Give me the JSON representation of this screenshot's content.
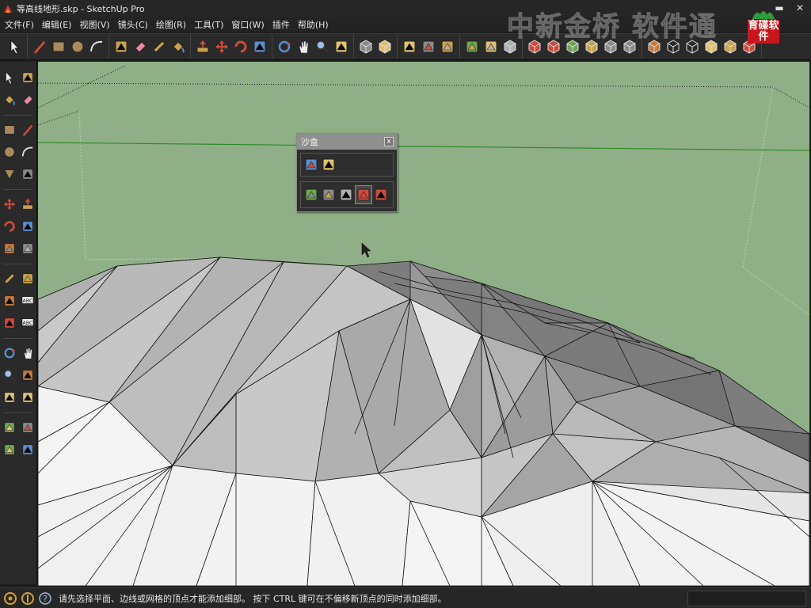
{
  "window": {
    "title": "等高线地形.skp - SketchUp Pro",
    "controls": [
      "minimize-icon",
      "close-icon"
    ]
  },
  "menu": [
    "文件(F)",
    "编辑(E)",
    "视图(V)",
    "镜头(C)",
    "绘图(R)",
    "工具(T)",
    "窗口(W)",
    "插件",
    "帮助(H)"
  ],
  "watermark": "中新金桥 软件通",
  "logo": "育碟软件",
  "top_toolbar_groups": [
    [
      "select-icon"
    ],
    [
      "pencil-icon",
      "rectangle-icon",
      "circle-icon",
      "arc-icon"
    ],
    [
      "make-component-icon",
      "eraser-icon",
      "tape-measure-icon",
      "paint-bucket-icon"
    ],
    [
      "push-pull-icon",
      "move-icon",
      "rotate-icon",
      "follow-me-icon"
    ],
    [
      "orbit-icon",
      "pan-icon",
      "zoom-icon",
      "zoom-extents-icon"
    ],
    [
      "previous-view-icon",
      "next-view-icon"
    ],
    [
      "3d-warehouse-icon",
      "share-model-icon",
      "google-earth-icon"
    ],
    [
      "get-models-icon",
      "share-component-icon",
      "preview-icon"
    ],
    [
      "iso-view-icon",
      "top-view-icon",
      "front-view-icon",
      "right-view-icon",
      "back-view-icon",
      "left-view-icon"
    ],
    [
      "xray-icon",
      "wireframe-icon",
      "hidden-line-icon",
      "shaded-icon",
      "shaded-textures-icon",
      "monochrome-icon"
    ]
  ],
  "left_toolbar_rows": [
    [
      "select-icon",
      "make-component-icon"
    ],
    [
      "paint-bucket-icon",
      "eraser-icon"
    ],
    "sep",
    [
      "rectangle-icon",
      "line-icon"
    ],
    [
      "circle-icon",
      "arc-icon"
    ],
    [
      "polygon-icon",
      "freehand-icon"
    ],
    "sep",
    [
      "move-icon",
      "push-pull-icon"
    ],
    [
      "rotate-icon",
      "follow-me-icon"
    ],
    [
      "scale-icon",
      "offset-icon"
    ],
    "sep",
    [
      "tape-measure-icon",
      "dimension-icon"
    ],
    [
      "protractor-icon",
      "text-icon"
    ],
    [
      "axes-icon",
      "3d-text-icon"
    ],
    "sep",
    [
      "orbit-icon",
      "pan-icon"
    ],
    [
      "zoom-icon",
      "zoom-window-icon"
    ],
    [
      "previous-icon",
      "zoom-extents-icon"
    ],
    "sep",
    [
      "position-camera-icon",
      "look-around-icon"
    ],
    [
      "walk-icon",
      "section-plane-icon"
    ]
  ],
  "sandbox_panel": {
    "title": "沙盒",
    "row1": [
      "from-contours-icon",
      "from-scratch-icon"
    ],
    "row2": [
      "smoove-icon",
      "stamp-icon",
      "drape-icon",
      "add-detail-icon",
      "flip-edge-icon"
    ],
    "active_tool": "add-detail-icon"
  },
  "status": {
    "icons": [
      "geolocation-icon",
      "credits-icon",
      "help-icon"
    ],
    "text": "请先选择平面、边线或网格的顶点才能添加细部。 按下 CTRL 键可在不偏移新顶点的同时添加细部。"
  }
}
